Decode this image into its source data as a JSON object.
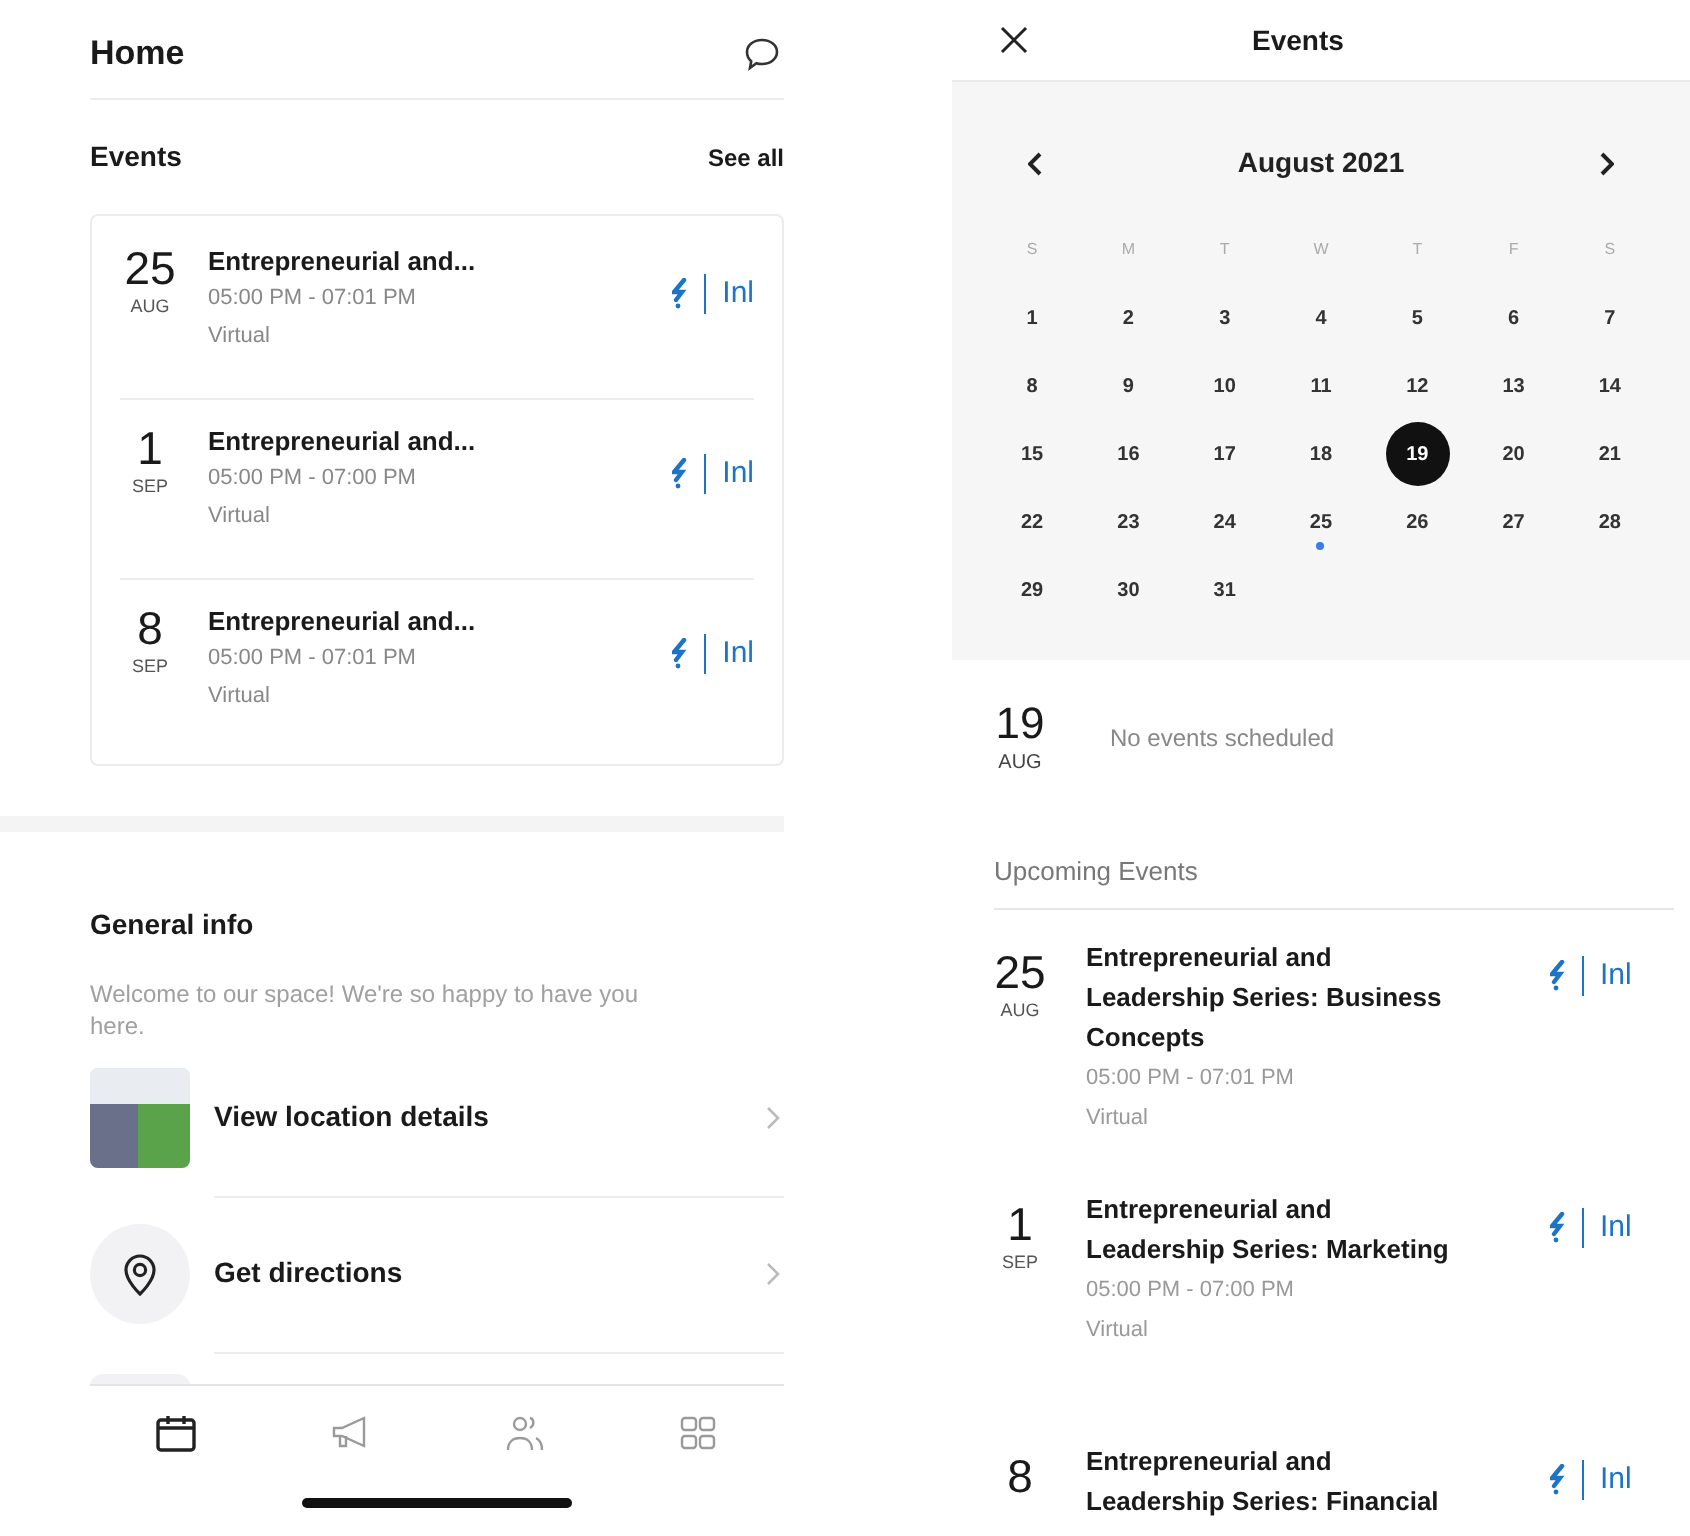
{
  "home": {
    "title": "Home",
    "events_heading": "Events",
    "see_all": "See all",
    "events": [
      {
        "day": "25",
        "month": "AUG",
        "title": "Entrepreneurial and...",
        "time": "05:00 PM - 07:01 PM",
        "location": "Virtual",
        "sponsor": "Inl"
      },
      {
        "day": "1",
        "month": "SEP",
        "title": "Entrepreneurial and...",
        "time": "05:00 PM - 07:00 PM",
        "location": "Virtual",
        "sponsor": "Inl"
      },
      {
        "day": "8",
        "month": "SEP",
        "title": "Entrepreneurial and...",
        "time": "05:00 PM - 07:01 PM",
        "location": "Virtual",
        "sponsor": "Inl"
      }
    ],
    "general_info": {
      "heading": "General info",
      "welcome": "Welcome to our space! We're so happy to have you here.",
      "items": [
        {
          "kind": "location",
          "label": "View location details"
        },
        {
          "kind": "directions",
          "label": "Get directions"
        }
      ]
    },
    "tabs": [
      {
        "kind": "calendar",
        "selected": true
      },
      {
        "kind": "megaphone",
        "selected": false
      },
      {
        "kind": "people",
        "selected": false
      },
      {
        "kind": "grid",
        "selected": false
      }
    ]
  },
  "events_screen": {
    "title": "Events",
    "calendar": {
      "month": "August 2021",
      "weekdays": [
        "S",
        "M",
        "T",
        "W",
        "T",
        "F",
        "S"
      ],
      "days": [
        {
          "label": "1",
          "selected": false,
          "has_event": false
        },
        {
          "label": "2",
          "selected": false,
          "has_event": false
        },
        {
          "label": "3",
          "selected": false,
          "has_event": false
        },
        {
          "label": "4",
          "selected": false,
          "has_event": false
        },
        {
          "label": "5",
          "selected": false,
          "has_event": false
        },
        {
          "label": "6",
          "selected": false,
          "has_event": false
        },
        {
          "label": "7",
          "selected": false,
          "has_event": false
        },
        {
          "label": "8",
          "selected": false,
          "has_event": false
        },
        {
          "label": "9",
          "selected": false,
          "has_event": false
        },
        {
          "label": "10",
          "selected": false,
          "has_event": false
        },
        {
          "label": "11",
          "selected": false,
          "has_event": false
        },
        {
          "label": "12",
          "selected": false,
          "has_event": false
        },
        {
          "label": "13",
          "selected": false,
          "has_event": false
        },
        {
          "label": "14",
          "selected": false,
          "has_event": false
        },
        {
          "label": "15",
          "selected": false,
          "has_event": false
        },
        {
          "label": "16",
          "selected": false,
          "has_event": false
        },
        {
          "label": "17",
          "selected": false,
          "has_event": false
        },
        {
          "label": "18",
          "selected": false,
          "has_event": false
        },
        {
          "label": "19",
          "selected": true,
          "has_event": false
        },
        {
          "label": "20",
          "selected": false,
          "has_event": false
        },
        {
          "label": "21",
          "selected": false,
          "has_event": false
        },
        {
          "label": "22",
          "selected": false,
          "has_event": false
        },
        {
          "label": "23",
          "selected": false,
          "has_event": false
        },
        {
          "label": "24",
          "selected": false,
          "has_event": false
        },
        {
          "label": "25",
          "selected": false,
          "has_event": true
        },
        {
          "label": "26",
          "selected": false,
          "has_event": false
        },
        {
          "label": "27",
          "selected": false,
          "has_event": false
        },
        {
          "label": "28",
          "selected": false,
          "has_event": false
        },
        {
          "label": "29",
          "selected": false,
          "has_event": false
        },
        {
          "label": "30",
          "selected": false,
          "has_event": false
        },
        {
          "label": "31",
          "selected": false,
          "has_event": false
        }
      ]
    },
    "selected_date": {
      "day": "19",
      "month": "AUG",
      "message": "No events scheduled"
    },
    "upcoming_heading": "Upcoming Events",
    "events": [
      {
        "day": "25",
        "month": "AUG",
        "title": "Entrepreneurial and Leadership Series: Business Concepts",
        "time": "05:00 PM - 07:01 PM",
        "location": "Virtual",
        "sponsor": "Inl"
      },
      {
        "day": "1",
        "month": "SEP",
        "title": "Entrepreneurial and Leadership Series: Marketing",
        "time": "05:00 PM - 07:00 PM",
        "location": "Virtual",
        "sponsor": "Inl"
      },
      {
        "day": "8",
        "title": "Entrepreneurial and Leadership Series: Financial",
        "sponsor": "Inl"
      }
    ]
  }
}
